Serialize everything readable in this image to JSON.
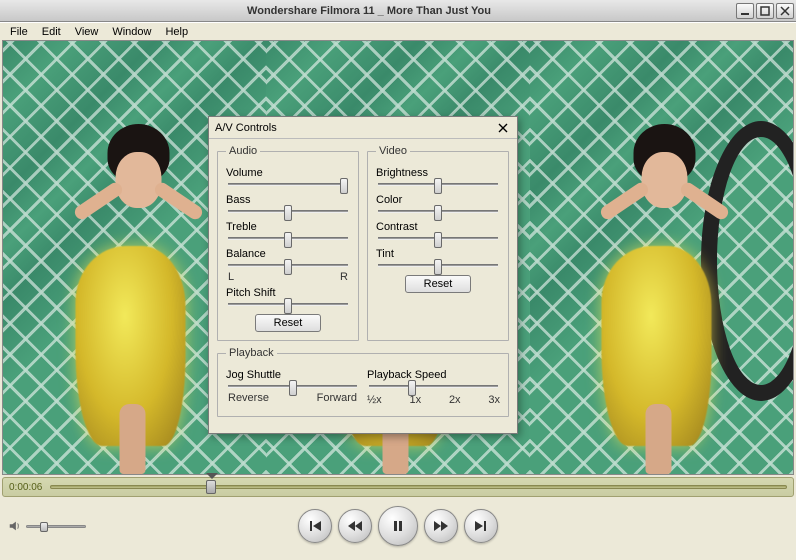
{
  "window": {
    "title": "Wondershare Filmora 11 _ More Than Just You"
  },
  "menus": [
    "File",
    "Edit",
    "View",
    "Window",
    "Help"
  ],
  "seek": {
    "time": "0:00:06",
    "pos_pct": 21
  },
  "volume": {
    "pos_pct": 22
  },
  "av": {
    "title": "A/V Controls",
    "audio": {
      "legend": "Audio",
      "volume": {
        "label": "Volume",
        "pos": 97
      },
      "bass": {
        "label": "Bass",
        "pos": 50
      },
      "treble": {
        "label": "Treble",
        "pos": 50
      },
      "balance": {
        "label": "Balance",
        "pos": 50,
        "left": "L",
        "right": "R"
      },
      "pitch": {
        "label": "Pitch Shift",
        "pos": 50
      },
      "reset": "Reset"
    },
    "video": {
      "legend": "Video",
      "brightness": {
        "label": "Brightness",
        "pos": 50
      },
      "color": {
        "label": "Color",
        "pos": 50
      },
      "contrast": {
        "label": "Contrast",
        "pos": 50
      },
      "tint": {
        "label": "Tint",
        "pos": 50
      },
      "reset": "Reset"
    },
    "playback": {
      "legend": "Playback",
      "jog": {
        "label": "Jog Shuttle",
        "pos": 50,
        "left": "Reverse",
        "right": "Forward"
      },
      "speed": {
        "label": "Playback Speed",
        "pos": 33,
        "ticks": [
          "½x",
          "1x",
          "2x",
          "3x"
        ]
      }
    }
  }
}
